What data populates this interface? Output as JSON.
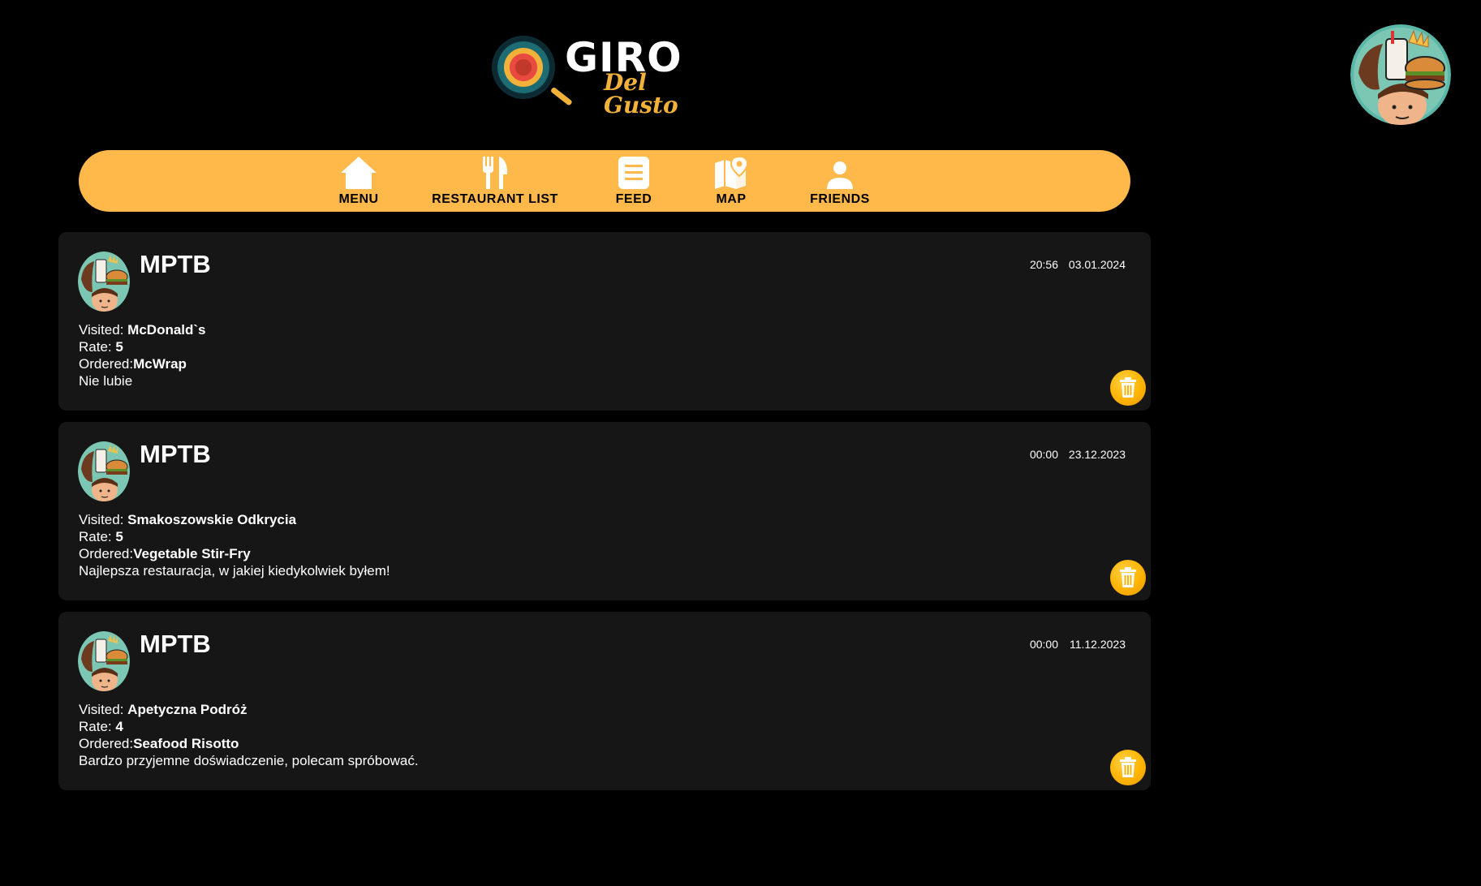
{
  "header": {
    "logo_title": "GIRO",
    "logo_subtitle": "Del Gusto",
    "profile_avatar_icon": "user-avatar-illustration"
  },
  "colors": {
    "accent": "#ffb84a",
    "delete": "#ffb300",
    "card_bg": "#161616",
    "page_bg": "#000000"
  },
  "nav": {
    "items": [
      {
        "label": "MENU",
        "icon": "home-icon"
      },
      {
        "label": "RESTAURANT LIST",
        "icon": "fork-knife-icon"
      },
      {
        "label": "FEED",
        "icon": "feed-list-icon"
      },
      {
        "label": "MAP",
        "icon": "map-pin-icon"
      },
      {
        "label": "FRIENDS",
        "icon": "person-icon"
      }
    ]
  },
  "posts": [
    {
      "user": "MPTB",
      "time": "20:56",
      "date": "03.01.2024",
      "visited_label": "Visited: ",
      "visited": "McDonald`s",
      "rate_label": "Rate: ",
      "rate": "5",
      "ordered_label": "Ordered:",
      "ordered": "McWrap",
      "comment": "Nie lubie"
    },
    {
      "user": "MPTB",
      "time": "00:00",
      "date": "23.12.2023",
      "visited_label": "Visited: ",
      "visited": "Smakoszowskie Odkrycia",
      "rate_label": "Rate: ",
      "rate": "5",
      "ordered_label": "Ordered:",
      "ordered": "Vegetable Stir-Fry",
      "comment": "Najlepsza restauracja, w jakiej kiedykolwiek byłem!"
    },
    {
      "user": "MPTB",
      "time": "00:00",
      "date": "11.12.2023",
      "visited_label": "Visited: ",
      "visited": "Apetyczna Podróż",
      "rate_label": "Rate: ",
      "rate": "4",
      "ordered_label": "Ordered:",
      "ordered": "Seafood Risotto",
      "comment": "Bardzo przyjemne doświadczenie, polecam spróbować."
    }
  ]
}
